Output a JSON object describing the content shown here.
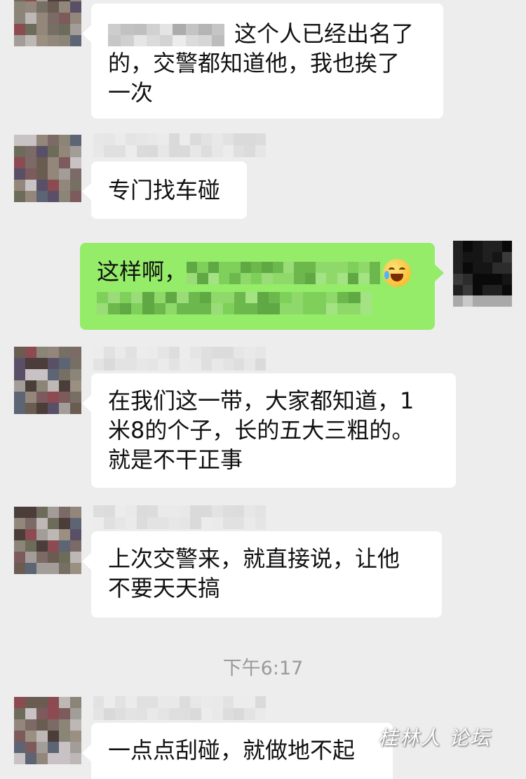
{
  "chat": {
    "messages": [
      {
        "side": "left",
        "line1_suffix": "这个人已经出名了",
        "line2": "的，交警都知道他，我也挨了",
        "line3": "一次"
      },
      {
        "side": "left",
        "text": "专门找车碰"
      },
      {
        "side": "right",
        "prefix": "这样啊，",
        "emoji": "crying-laughing-emoji"
      },
      {
        "side": "left",
        "text": "在我们这一带，大家都知道，1\n米8的个子，长的五大三粗的。\n就是不干正事"
      },
      {
        "side": "left",
        "text": "上次交警来，就直接说，让他\n不要天天搞"
      },
      {
        "side": "left",
        "text": "一点点刮碰，就做地不起"
      }
    ],
    "timestamp": "下午6:17",
    "watermark": "桂林人 论坛"
  },
  "colors": {
    "background": "#ededed",
    "incoming_bubble": "#ffffff",
    "outgoing_bubble": "#95ec69",
    "timestamp": "#9a9a9a"
  }
}
